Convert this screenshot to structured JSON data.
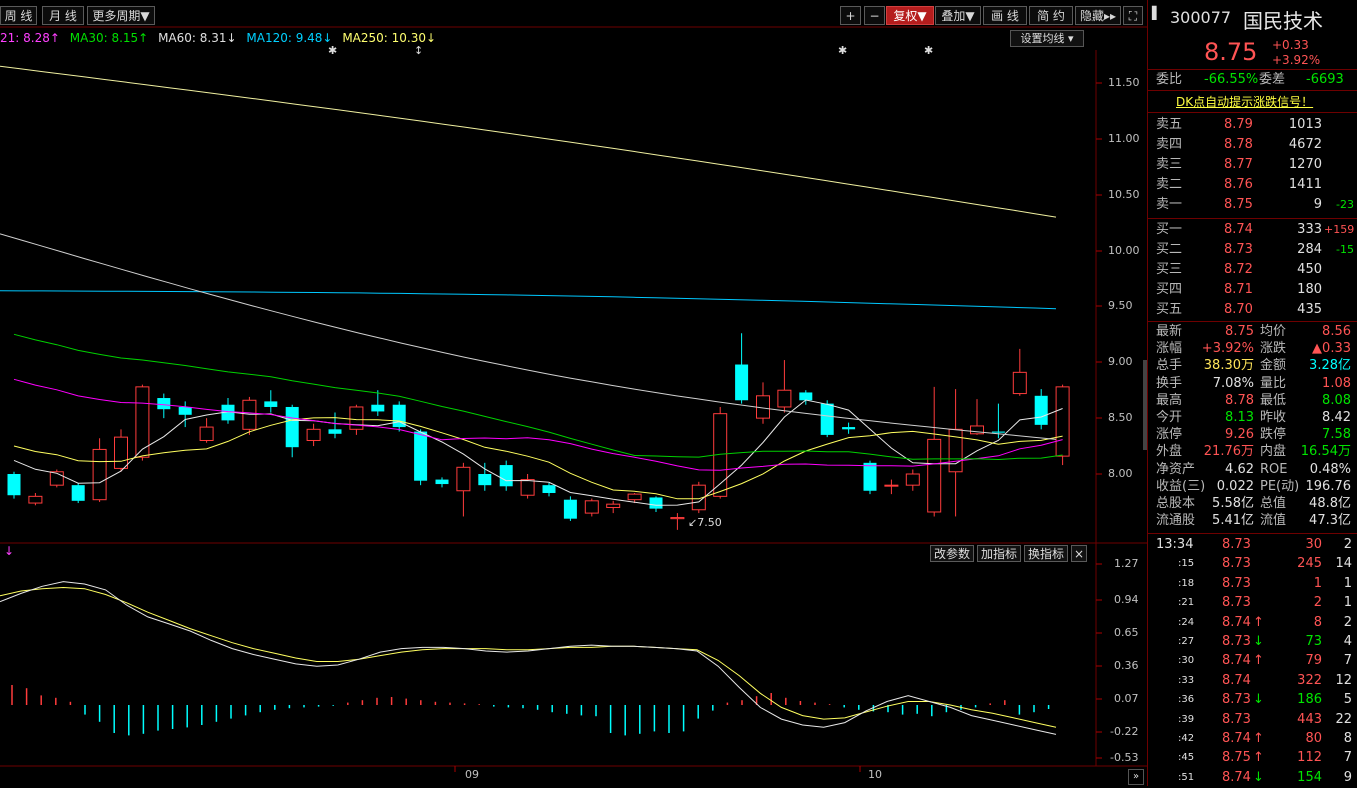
{
  "toolbar": {
    "weekly": "周 线",
    "monthly": "月 线",
    "more_period": "更多周期",
    "zoom_in": "+",
    "zoom_out": "−",
    "adjust": "复权",
    "overlay": "叠加",
    "draw": "画 线",
    "simple": "简 约",
    "hide": "隐藏",
    "fullscreen": "⛶"
  },
  "ma_legend": {
    "ma21": "21: 8.28",
    "ma30": "MA30: 8.15",
    "ma60": "MA60: 8.31",
    "ma120": "MA120: 9.48",
    "ma250": "MA250: 10.30"
  },
  "set_ma_button": "设置均线",
  "price_axis": [
    "11.50",
    "11.00",
    "10.50",
    "10.00",
    "9.50",
    "9.00",
    "8.50",
    "8.00"
  ],
  "low_marker": "7.50",
  "sub_axis": [
    "1.27",
    "0.94",
    "0.65",
    "0.36",
    "0.07",
    "-0.22",
    "-0.53"
  ],
  "sub_buttons": {
    "params": "改参数",
    "add": "加指标",
    "switch": "换指标",
    "close": "×"
  },
  "x_labels": [
    "09",
    "10"
  ],
  "colors": {
    "up": "#ff3c3c",
    "down": "#00ffff",
    "ma_white": "#e8e8e8",
    "ma_yellow": "#ffff60",
    "ma_magenta": "#ff00ff",
    "ma_green": "#00d000",
    "ma_cyan": "#00c8ff",
    "ma_pale": "#f0f0a0"
  },
  "quote": {
    "code": "300077",
    "name": "国民技术",
    "price": "8.75",
    "change": "+0.33",
    "change_pct": "+3.92%",
    "weibi_label": "委比",
    "weibi": "-66.55%",
    "weicha_label": "委差",
    "weicha": "-6693",
    "banner": "DK点自动提示涨跌信号！",
    "asks": [
      {
        "label": "卖五",
        "price": "8.79",
        "vol": "1013",
        "chg": ""
      },
      {
        "label": "卖四",
        "price": "8.78",
        "vol": "4672",
        "chg": ""
      },
      {
        "label": "卖三",
        "price": "8.77",
        "vol": "1270",
        "chg": ""
      },
      {
        "label": "卖二",
        "price": "8.76",
        "vol": "1411",
        "chg": ""
      },
      {
        "label": "卖一",
        "price": "8.75",
        "vol": "9",
        "chg": "-23"
      }
    ],
    "bids": [
      {
        "label": "买一",
        "price": "8.74",
        "vol": "333",
        "chg": "+159"
      },
      {
        "label": "买二",
        "price": "8.73",
        "vol": "284",
        "chg": "-15"
      },
      {
        "label": "买三",
        "price": "8.72",
        "vol": "450",
        "chg": ""
      },
      {
        "label": "买四",
        "price": "8.71",
        "vol": "180",
        "chg": ""
      },
      {
        "label": "买五",
        "price": "8.70",
        "vol": "435",
        "chg": ""
      }
    ],
    "stats": [
      [
        "最新",
        "8.75",
        "均价",
        "8.56"
      ],
      [
        "涨幅",
        "+3.92%",
        "涨跌",
        "▲0.33"
      ],
      [
        "总手",
        "38.30万",
        "金额",
        "3.28亿"
      ],
      [
        "换手",
        "7.08%",
        "量比",
        "1.08"
      ],
      [
        "最高",
        "8.78",
        "最低",
        "8.08"
      ],
      [
        "今开",
        "8.13",
        "昨收",
        "8.42"
      ],
      [
        "涨停",
        "9.26",
        "跌停",
        "7.58"
      ],
      [
        "外盘",
        "21.76万",
        "内盘",
        "16.54万"
      ],
      [
        "净资产",
        "4.62",
        "ROE",
        "0.48%"
      ],
      [
        "收益(三)",
        "0.022",
        "PE(动)",
        "196.76"
      ],
      [
        "总股本",
        "5.58亿",
        "总值",
        "48.8亿"
      ],
      [
        "流通股",
        "5.41亿",
        "流值",
        "47.3亿"
      ]
    ],
    "ticks": [
      {
        "t": "13:34",
        "p": "8.73",
        "arrow": "",
        "v": "30",
        "n": "2"
      },
      {
        "t": ":15",
        "p": "8.73",
        "arrow": "",
        "v": "245",
        "n": "14"
      },
      {
        "t": ":18",
        "p": "8.73",
        "arrow": "",
        "v": "1",
        "n": "1"
      },
      {
        "t": ":21",
        "p": "8.73",
        "arrow": "",
        "v": "2",
        "n": "1"
      },
      {
        "t": ":24",
        "p": "8.74",
        "arrow": "↑",
        "v": "8",
        "n": "2"
      },
      {
        "t": ":27",
        "p": "8.73",
        "arrow": "↓",
        "v": "73",
        "n": "4"
      },
      {
        "t": ":30",
        "p": "8.74",
        "arrow": "↑",
        "v": "79",
        "n": "7"
      },
      {
        "t": ":33",
        "p": "8.74",
        "arrow": "",
        "v": "322",
        "n": "12"
      },
      {
        "t": ":36",
        "p": "8.73",
        "arrow": "↓",
        "v": "186",
        "n": "5"
      },
      {
        "t": ":39",
        "p": "8.73",
        "arrow": "",
        "v": "443",
        "n": "22"
      },
      {
        "t": ":42",
        "p": "8.74",
        "arrow": "↑",
        "v": "80",
        "n": "8"
      },
      {
        "t": ":45",
        "p": "8.75",
        "arrow": "↑",
        "v": "112",
        "n": "7"
      },
      {
        "t": ":51",
        "p": "8.74",
        "arrow": "↓",
        "v": "154",
        "n": "9"
      }
    ]
  },
  "candles": [
    [
      8.0,
      7.81,
      8.02,
      7.78
    ],
    [
      7.74,
      7.8,
      7.83,
      7.72
    ],
    [
      7.9,
      8.02,
      8.04,
      7.88
    ],
    [
      7.9,
      7.76,
      7.92,
      7.74
    ],
    [
      7.77,
      8.22,
      8.32,
      7.75
    ],
    [
      8.05,
      8.33,
      8.4,
      8.02
    ],
    [
      8.15,
      8.78,
      8.8,
      8.12
    ],
    [
      8.68,
      8.58,
      8.72,
      8.5
    ],
    [
      8.6,
      8.53,
      8.65,
      8.42
    ],
    [
      8.3,
      8.42,
      8.5,
      8.28
    ],
    [
      8.62,
      8.48,
      8.68,
      8.45
    ],
    [
      8.4,
      8.66,
      8.69,
      8.35
    ],
    [
      8.65,
      8.6,
      8.75,
      8.55
    ],
    [
      8.6,
      8.24,
      8.62,
      8.15
    ],
    [
      8.3,
      8.4,
      8.45,
      8.25
    ],
    [
      8.4,
      8.36,
      8.55,
      8.32
    ],
    [
      8.4,
      8.6,
      8.62,
      8.35
    ],
    [
      8.62,
      8.56,
      8.75,
      8.52
    ],
    [
      8.62,
      8.42,
      8.65,
      8.38
    ],
    [
      8.38,
      7.94,
      8.4,
      7.9
    ],
    [
      7.95,
      7.91,
      7.97,
      7.88
    ],
    [
      7.85,
      8.06,
      8.1,
      7.62
    ],
    [
      8.0,
      7.9,
      8.1,
      7.85
    ],
    [
      8.08,
      7.89,
      8.12,
      7.85
    ],
    [
      7.81,
      7.95,
      8.0,
      7.78
    ],
    [
      7.9,
      7.83,
      7.92,
      7.8
    ],
    [
      7.77,
      7.6,
      7.8,
      7.58
    ],
    [
      7.65,
      7.76,
      7.78,
      7.62
    ],
    [
      7.7,
      7.73,
      7.76,
      7.65
    ],
    [
      7.77,
      7.82,
      7.83,
      7.74
    ],
    [
      7.79,
      7.69,
      7.8,
      7.66
    ],
    [
      7.6,
      7.61,
      7.65,
      7.5
    ],
    [
      7.68,
      7.9,
      7.93,
      7.65
    ],
    [
      7.8,
      8.54,
      8.6,
      7.78
    ],
    [
      8.98,
      8.66,
      9.26,
      8.63
    ],
    [
      8.5,
      8.7,
      8.82,
      8.45
    ],
    [
      8.6,
      8.75,
      9.02,
      8.55
    ],
    [
      8.73,
      8.66,
      8.75,
      8.62
    ],
    [
      8.63,
      8.35,
      8.66,
      8.33
    ],
    [
      8.42,
      8.4,
      8.46,
      8.36
    ],
    [
      8.1,
      7.85,
      8.12,
      7.82
    ],
    [
      7.9,
      7.9,
      7.95,
      7.82
    ],
    [
      7.9,
      8.0,
      8.04,
      7.85
    ],
    [
      7.66,
      8.31,
      8.78,
      7.62
    ],
    [
      8.02,
      8.4,
      8.76,
      7.62
    ],
    [
      8.36,
      8.43,
      8.67,
      8.35
    ],
    [
      8.38,
      8.37,
      8.63,
      8.32
    ],
    [
      8.72,
      8.91,
      9.12,
      8.7
    ],
    [
      8.7,
      8.44,
      8.76,
      8.4
    ],
    [
      8.16,
      8.78,
      8.8,
      8.08
    ]
  ],
  "macd_bars": [
    0.25,
    0.21,
    0.12,
    0.09,
    0.04,
    -0.12,
    -0.21,
    -0.35,
    -0.38,
    -0.36,
    -0.32,
    -0.3,
    -0.28,
    -0.25,
    -0.21,
    -0.17,
    -0.13,
    -0.09,
    -0.06,
    -0.04,
    -0.03,
    -0.02,
    -0.01,
    0.03,
    0.06,
    0.09,
    0.1,
    0.08,
    0.06,
    0.04,
    0.03,
    0.02,
    0.01,
    -0.02,
    -0.03,
    -0.04,
    -0.06,
    -0.09,
    -0.11,
    -0.13,
    -0.14,
    -0.35,
    -0.38,
    -0.36,
    -0.33,
    -0.35,
    -0.33,
    -0.17,
    -0.07,
    0.03,
    0.06,
    0.11,
    0.15,
    0.09,
    0.05,
    0.03,
    0.01,
    -0.03,
    -0.06,
    -0.08,
    -0.09,
    -0.12,
    -0.11,
    -0.14,
    -0.09,
    -0.06,
    -0.03,
    0.02,
    0.06,
    -0.12,
    -0.09,
    -0.05
  ]
}
